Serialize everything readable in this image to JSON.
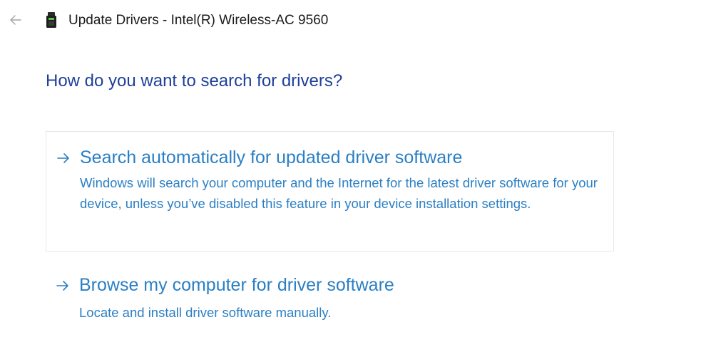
{
  "window": {
    "title": "Update Drivers - Intel(R) Wireless-AC 9560",
    "back_icon": "back-arrow-icon",
    "device_icon": "network-adapter-icon"
  },
  "heading": "How do you want to search for drivers?",
  "options": [
    {
      "title": "Search automatically for updated driver software",
      "description": "Windows will search your computer and the Internet for the latest driver software for your device, unless you’ve disabled this feature in your device installation settings.",
      "icon": "arrow-right-icon",
      "selected": true
    },
    {
      "title": "Browse my computer for driver software",
      "description": "Locate and install driver software manually.",
      "icon": "arrow-right-icon",
      "selected": false
    }
  ],
  "colors": {
    "heading": "#1f3f9a",
    "link": "#2b7fc4",
    "selected_border": "#e2e8ef",
    "back_arrow": "#9a9a9a"
  }
}
